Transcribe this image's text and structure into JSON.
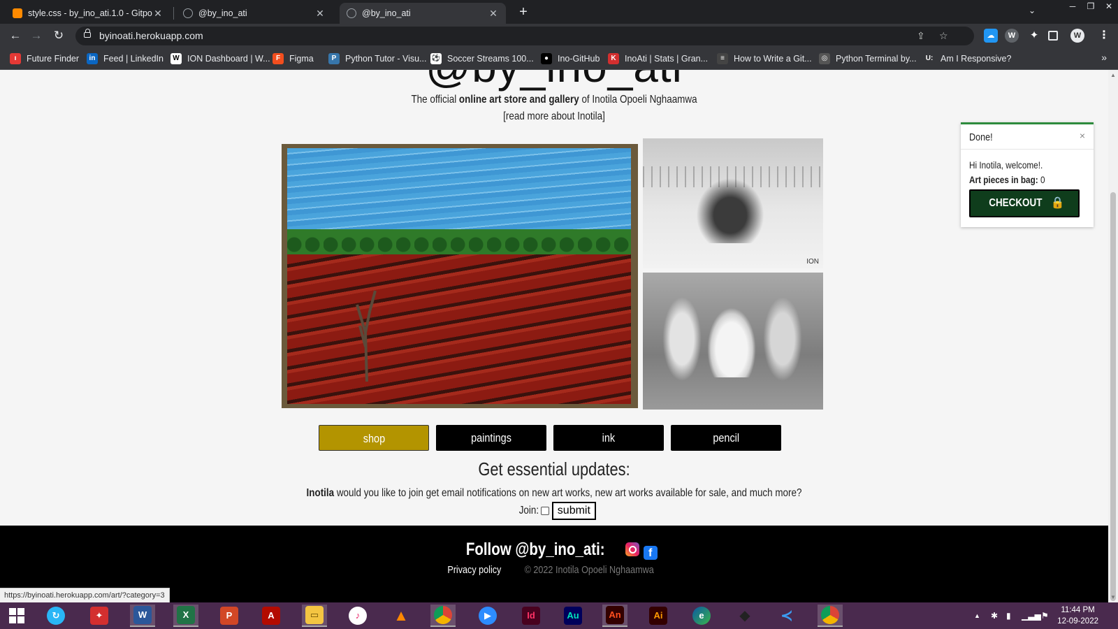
{
  "browser": {
    "tabs": [
      {
        "title": "style.css - by_ino_ati.1.0 - Gitpod",
        "icon": "gitpod-icon",
        "active": false
      },
      {
        "title": "@by_ino_ati",
        "icon": "globe-icon",
        "active": false
      },
      {
        "title": "@by_ino_ati",
        "icon": "globe-icon",
        "active": true
      }
    ],
    "url": "byinoati.herokuapp.com",
    "bookmarks": [
      {
        "label": "Future Finder",
        "color": "#e53935",
        "glyph": "ı"
      },
      {
        "label": "Feed | LinkedIn",
        "color": "#0a66c2",
        "glyph": "in"
      },
      {
        "label": "ION Dashboard | W...",
        "color": "#ffffff",
        "glyph": "W"
      },
      {
        "label": "Figma",
        "color": "#f24e1e",
        "glyph": "F"
      },
      {
        "label": "Python Tutor - Visu...",
        "color": "#3776ab",
        "glyph": "P"
      },
      {
        "label": "Soccer Streams 100...",
        "color": "#ffffff",
        "glyph": "⚽"
      },
      {
        "label": "Ino-GitHub",
        "color": "#000000",
        "glyph": "●"
      },
      {
        "label": "InoAti | Stats | Gran...",
        "color": "#d32f2f",
        "glyph": "K"
      },
      {
        "label": "How to Write a Git...",
        "color": "#444444",
        "glyph": "≡"
      },
      {
        "label": "Python Terminal by...",
        "color": "#555555",
        "glyph": "◎"
      },
      {
        "label": "Am I Responsive?",
        "color": "#35363a",
        "glyph": "U:"
      }
    ]
  },
  "page": {
    "brand": "@by_ino_ati",
    "tagline_prefix": "The official ",
    "tagline_bold": "online art store and gallery",
    "tagline_suffix": " of Inotila Opoeli Nghaamwa",
    "read_more": "[read more about Inotila]",
    "categories": [
      {
        "label": "shop",
        "active": true
      },
      {
        "label": "paintings",
        "active": false
      },
      {
        "label": "ink",
        "active": false
      },
      {
        "label": "pencil",
        "active": false
      }
    ],
    "updates_heading": "Get essential updates:",
    "updates_name": "Inotila",
    "updates_text": " would you like to join get email notifications on new art works, new art works available for sale, and much more?",
    "join_label": "Join:",
    "submit_label": "submit",
    "footer_follow": "Follow @by_ino_ati:",
    "privacy_label": "Privacy policy",
    "copyright": "© 2022 Inotila Opoeli Nghaamwa",
    "status_url": "https://byinoati.herokuapp.com/art/?category=3",
    "accent_color": "#b39400"
  },
  "toast": {
    "title": "Done!",
    "close": "×",
    "message": "Hi Inotila, welcome!.",
    "bag_label": "Art pieces in bag:",
    "bag_count": "0",
    "checkout_label": "CHECKOUT"
  },
  "taskbar": {
    "time": "11:44 PM",
    "date": "12-09-2022"
  }
}
